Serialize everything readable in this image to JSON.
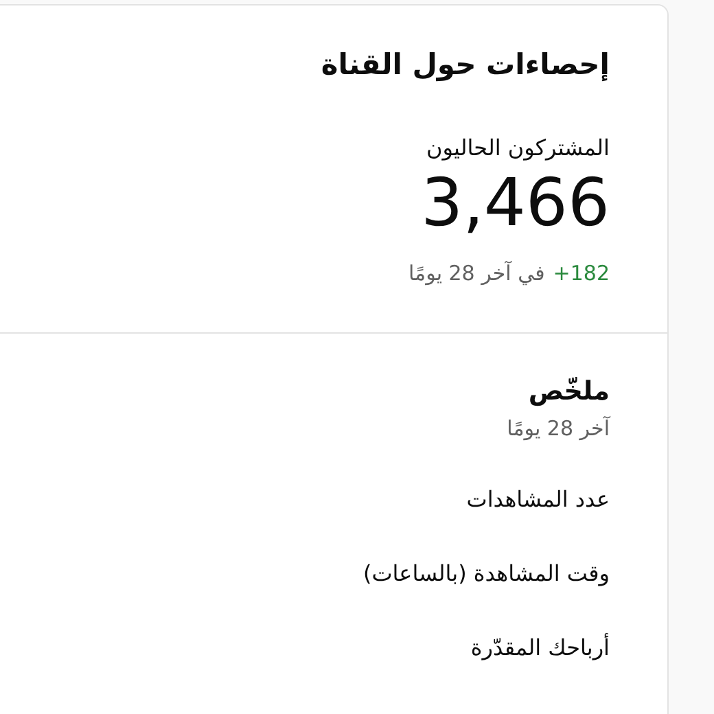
{
  "card": {
    "title": "إحصاءات حول القناة",
    "subscribers": {
      "label": "المشتركون الحاليون",
      "value": "3,466",
      "change": "+182",
      "change_period": "في آخر 28 يومًا"
    },
    "summary": {
      "title": "ملخّص",
      "period": "آخر 28 يومًا",
      "metrics": [
        {
          "label": "عدد المشاهدات"
        },
        {
          "label": "وقت المشاهدة (بالساعات)"
        },
        {
          "label": "أرباحك المقدّرة"
        }
      ]
    }
  }
}
